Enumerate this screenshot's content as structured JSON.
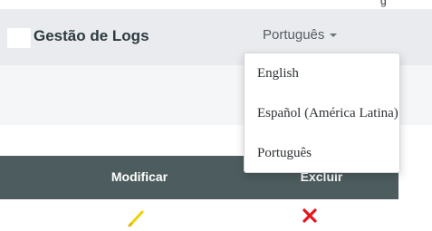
{
  "top_strip": {
    "text": "g"
  },
  "navbar": {
    "title": "Gestão de Logs",
    "language_toggle": "Português",
    "background": "#e9ebee"
  },
  "language_menu": {
    "options": [
      "English",
      "Español (América Latina)",
      "Português"
    ]
  },
  "table": {
    "headers": {
      "modify": "Modificar",
      "delete": "Excluir"
    },
    "header_background": "#4d5d5f",
    "rows": [
      {
        "edit_icon": "pencil-icon",
        "delete_icon": "close-icon"
      }
    ]
  },
  "colors": {
    "edit_icon": "#f0d000",
    "delete_icon": "#e8141c"
  }
}
